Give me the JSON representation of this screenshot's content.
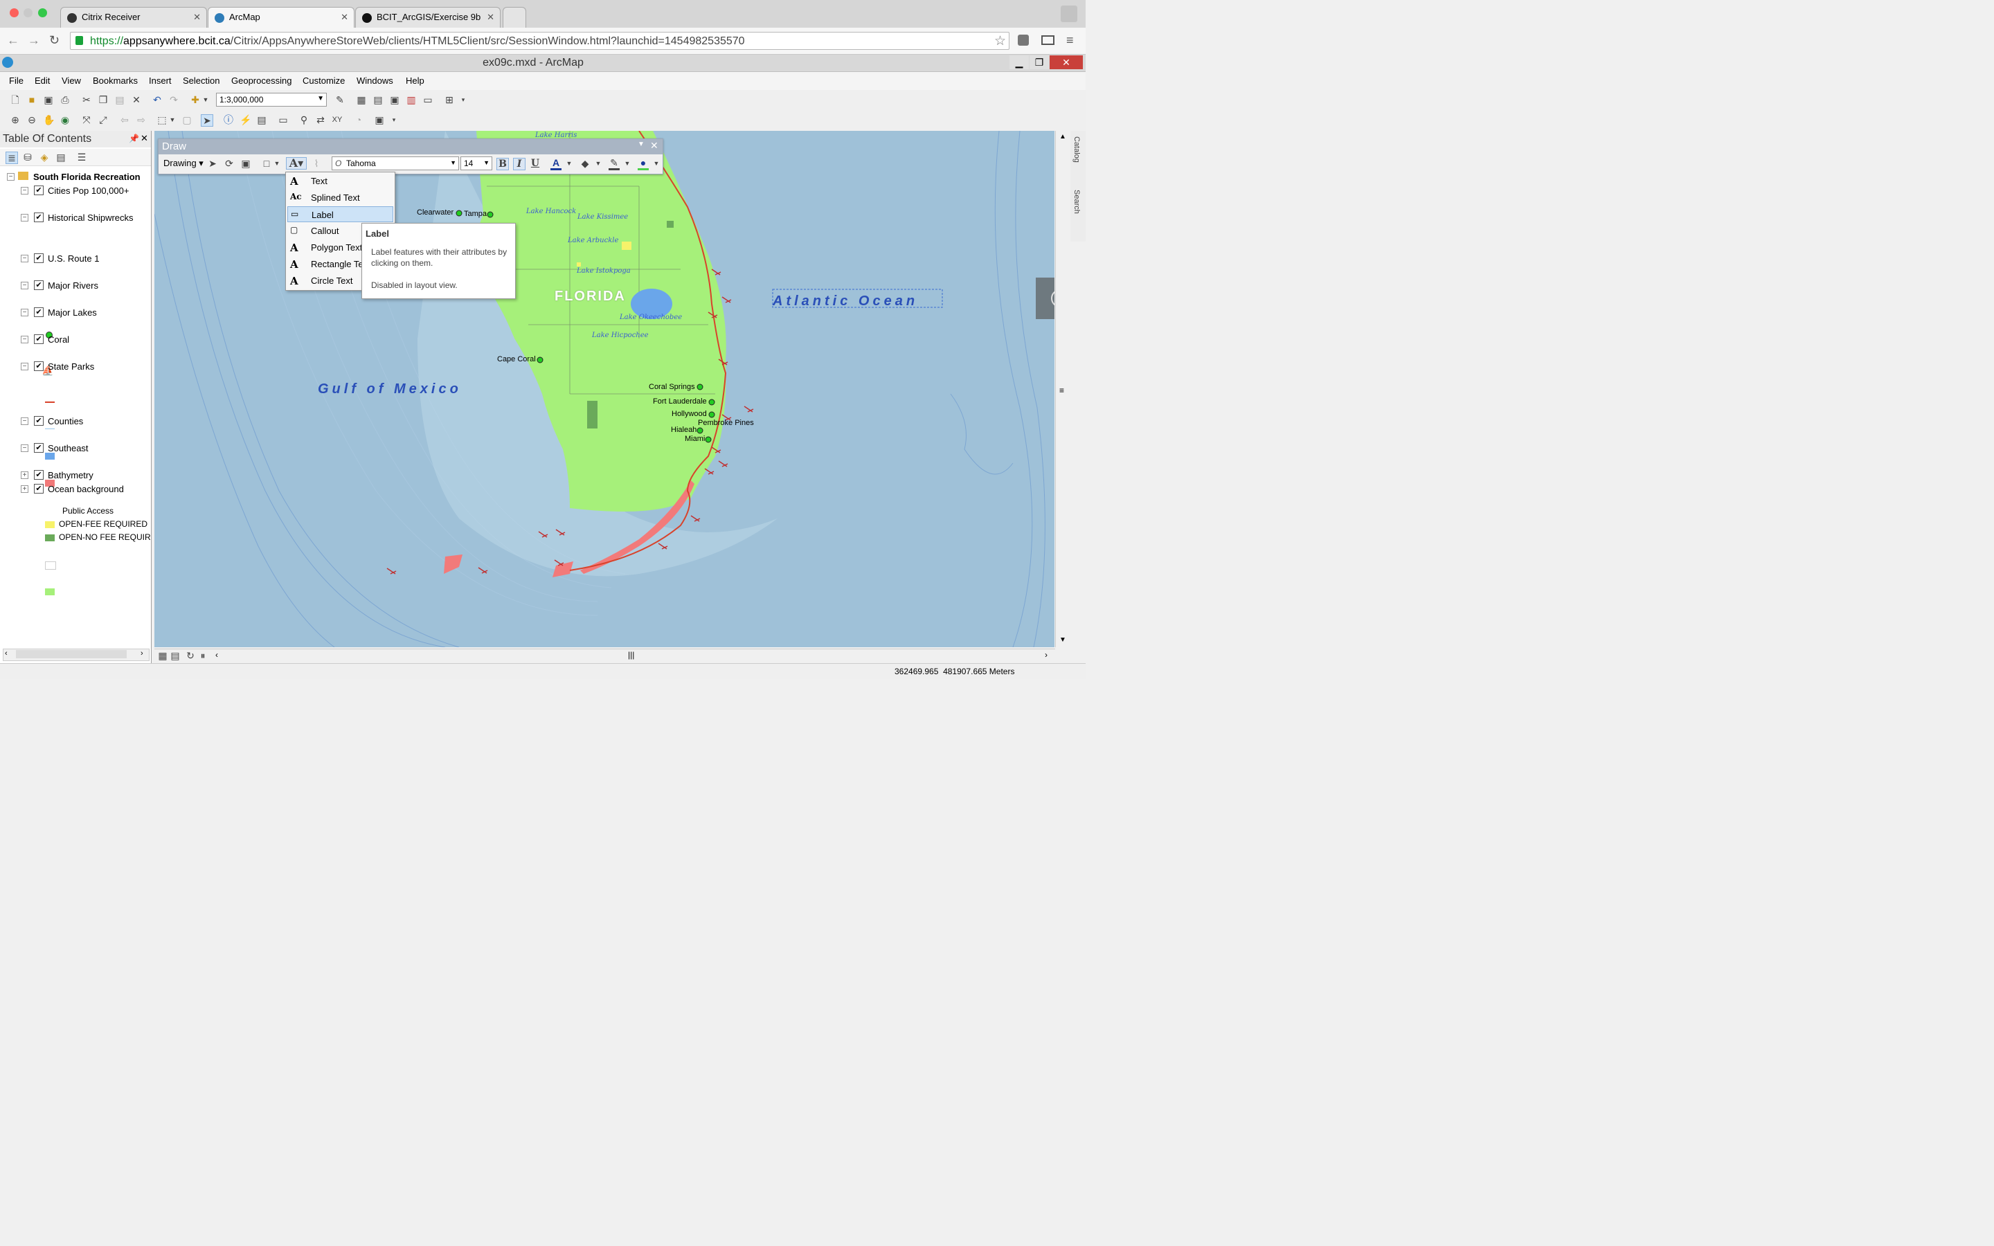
{
  "browser": {
    "tabs": [
      {
        "label": "Citrix Receiver"
      },
      {
        "label": "ArcMap"
      },
      {
        "label": "BCIT_ArcGIS/Exercise 9b"
      }
    ],
    "url_scheme": "https://",
    "url_host": "appsanywhere.bcit.ca",
    "url_path": "/Citrix/AppsAnywhereStoreWeb/clients/HTML5Client/src/SessionWindow.html?launchid=1454982535570"
  },
  "window": {
    "title": "ex09c.mxd - ArcMap"
  },
  "menubar": [
    "File",
    "Edit",
    "View",
    "Bookmarks",
    "Insert",
    "Selection",
    "Geoprocessing",
    "Customize",
    "Windows",
    "Help"
  ],
  "toolbar": {
    "scale": "1:3,000,000"
  },
  "toc": {
    "title": "Table Of Contents",
    "group": "South Florida Recreation",
    "layers": [
      {
        "name": "Cities Pop 100,000+"
      },
      {
        "name": "Historical Shipwrecks"
      },
      {
        "name": "U.S. Route 1"
      },
      {
        "name": "Major Rivers"
      },
      {
        "name": "Major Lakes"
      },
      {
        "name": "Coral"
      },
      {
        "name": "State Parks"
      },
      {
        "name": "Counties"
      },
      {
        "name": "Southeast"
      },
      {
        "name": "Bathymetry"
      },
      {
        "name": "Ocean background"
      }
    ],
    "state_parks_field": "Public Access",
    "state_parks_classes": [
      "OPEN-FEE REQUIRED",
      "OPEN-NO FEE REQUIR"
    ],
    "colors": {
      "cities": "#22cc22",
      "route": "#d8432b",
      "rivers": "#9cc8ea",
      "lakes": "#6aa6ea",
      "coral": "#f27a7a",
      "fee": "#f7f26a",
      "nofee": "#6aaa5a",
      "southeast": "#a6f07a"
    }
  },
  "draw": {
    "title": "Draw",
    "drawing_menu": "Drawing",
    "font": "Tahoma",
    "font_size": "14",
    "bold": "B",
    "italic": "I",
    "underline": "U",
    "text_menu": [
      "Text",
      "Splined Text",
      "Label",
      "Callout",
      "Polygon Text",
      "Rectangle Text",
      "Circle Text"
    ],
    "tooltip": {
      "title": "Label",
      "body": "Label features with their attributes by clicking on them.",
      "note": "Disabled in layout view."
    }
  },
  "map": {
    "state_label": "FLORIDA",
    "gulf_label": "Gulf of Mexico",
    "ocean_label": "Atlantic Ocean",
    "lake_top": "Lake Harris",
    "lakes": [
      "Lake Hancock",
      "Lake Kissimee",
      "Lake Arbuckle",
      "Lake Istokpoga",
      "Lake Okeechobee",
      "Lake Hicpochee"
    ],
    "cities": [
      "Clearwater",
      "Tampa",
      "Cape Coral",
      "Coral Springs",
      "Fort Lauderdale",
      "Hollywood",
      "Pembroke Pines",
      "Hialeah",
      "Miami"
    ],
    "colors": {
      "ocean": "#9fc1d8",
      "land": "#a6f07a",
      "label_blue": "#2a4fb8"
    }
  },
  "status": {
    "coordinates": "362469.965  481907.665 Meters"
  }
}
